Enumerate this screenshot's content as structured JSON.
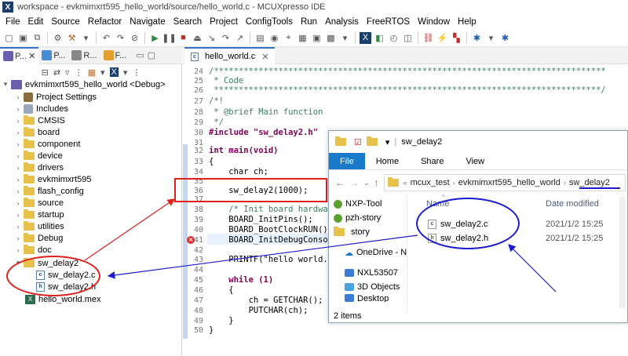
{
  "window": {
    "title": "workspace - evkmimxrt595_hello_world/source/hello_world.c - MCUXpresso IDE"
  },
  "menu": [
    "File",
    "Edit",
    "Source",
    "Refactor",
    "Navigate",
    "Search",
    "Project",
    "ConfigTools",
    "Run",
    "Analysis",
    "FreeRTOS",
    "Window",
    "Help"
  ],
  "left_tabs": [
    "P...",
    "P...",
    "R...",
    "F..."
  ],
  "tree": {
    "project": "evkmimxrt595_hello_world <Debug>",
    "items": [
      "Project Settings",
      "Includes",
      "CMSIS",
      "board",
      "component",
      "device",
      "drivers",
      "evkmimxrt595",
      "flash_config",
      "source",
      "startup",
      "utilities",
      "Debug",
      "doc",
      "sw_delay2",
      "sw_delay2.c",
      "sw_delay2.h",
      "hello_world.mex"
    ]
  },
  "editor": {
    "tab": "hello_world.c",
    "line_numbers": [
      "24",
      "25",
      "26",
      "27",
      "28",
      "29",
      "30",
      "31",
      "32",
      "33",
      "34",
      "35",
      "36",
      "37",
      "38",
      "39",
      "40",
      "41",
      "42",
      "43",
      "44",
      "45",
      "46",
      "47",
      "48",
      "49",
      "50"
    ],
    "lines": [
      "/*******************************************************************************",
      " * Code",
      " ******************************************************************************/",
      "/*!",
      " * @brief Main function",
      " */",
      "#include \"sw_delay2.h\"",
      "",
      "int main(void)",
      "{",
      "    char ch;",
      "",
      "    sw_delay2(1000);",
      "",
      "    /* Init board hardware. */",
      "    BOARD_InitPins();",
      "    BOARD_BootClockRUN();",
      "    BOARD_InitDebugConsole();",
      "",
      "    PRINTF(\"hello world.\\r\\n\");",
      "",
      "    while (1)",
      "    {",
      "        ch = GETCHAR();",
      "        PUTCHAR(ch);",
      "    }",
      "}"
    ]
  },
  "explorer": {
    "title": "sw_delay2",
    "ribbon": [
      "File",
      "Home",
      "Share",
      "View"
    ],
    "breadcrumb": [
      "mcux_test",
      "evkmimxrt595_hello_world",
      "sw_delay2"
    ],
    "nav": [
      "NXP-Tool",
      "pzh-story",
      "story",
      "OneDrive - N",
      "NXL53507",
      "3D Objects",
      "Desktop"
    ],
    "columns": [
      "Name",
      "Date modified"
    ],
    "files": [
      {
        "name": "sw_delay2.c",
        "date": "2021/1/2 15:25"
      },
      {
        "name": "sw_delay2.h",
        "date": "2021/1/2 15:25"
      }
    ],
    "status": "2 items"
  }
}
